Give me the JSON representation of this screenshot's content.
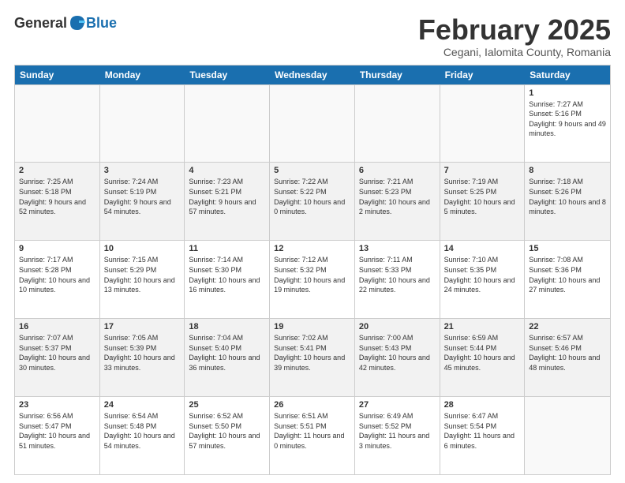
{
  "header": {
    "logo": {
      "general": "General",
      "blue": "Blue"
    },
    "title": "February 2025",
    "location": "Cegani, Ialomita County, Romania"
  },
  "weekdays": [
    "Sunday",
    "Monday",
    "Tuesday",
    "Wednesday",
    "Thursday",
    "Friday",
    "Saturday"
  ],
  "weeks": [
    [
      {
        "day": "",
        "info": ""
      },
      {
        "day": "",
        "info": ""
      },
      {
        "day": "",
        "info": ""
      },
      {
        "day": "",
        "info": ""
      },
      {
        "day": "",
        "info": ""
      },
      {
        "day": "",
        "info": ""
      },
      {
        "day": "1",
        "info": "Sunrise: 7:27 AM\nSunset: 5:16 PM\nDaylight: 9 hours and 49 minutes."
      }
    ],
    [
      {
        "day": "2",
        "info": "Sunrise: 7:25 AM\nSunset: 5:18 PM\nDaylight: 9 hours and 52 minutes."
      },
      {
        "day": "3",
        "info": "Sunrise: 7:24 AM\nSunset: 5:19 PM\nDaylight: 9 hours and 54 minutes."
      },
      {
        "day": "4",
        "info": "Sunrise: 7:23 AM\nSunset: 5:21 PM\nDaylight: 9 hours and 57 minutes."
      },
      {
        "day": "5",
        "info": "Sunrise: 7:22 AM\nSunset: 5:22 PM\nDaylight: 10 hours and 0 minutes."
      },
      {
        "day": "6",
        "info": "Sunrise: 7:21 AM\nSunset: 5:23 PM\nDaylight: 10 hours and 2 minutes."
      },
      {
        "day": "7",
        "info": "Sunrise: 7:19 AM\nSunset: 5:25 PM\nDaylight: 10 hours and 5 minutes."
      },
      {
        "day": "8",
        "info": "Sunrise: 7:18 AM\nSunset: 5:26 PM\nDaylight: 10 hours and 8 minutes."
      }
    ],
    [
      {
        "day": "9",
        "info": "Sunrise: 7:17 AM\nSunset: 5:28 PM\nDaylight: 10 hours and 10 minutes."
      },
      {
        "day": "10",
        "info": "Sunrise: 7:15 AM\nSunset: 5:29 PM\nDaylight: 10 hours and 13 minutes."
      },
      {
        "day": "11",
        "info": "Sunrise: 7:14 AM\nSunset: 5:30 PM\nDaylight: 10 hours and 16 minutes."
      },
      {
        "day": "12",
        "info": "Sunrise: 7:12 AM\nSunset: 5:32 PM\nDaylight: 10 hours and 19 minutes."
      },
      {
        "day": "13",
        "info": "Sunrise: 7:11 AM\nSunset: 5:33 PM\nDaylight: 10 hours and 22 minutes."
      },
      {
        "day": "14",
        "info": "Sunrise: 7:10 AM\nSunset: 5:35 PM\nDaylight: 10 hours and 24 minutes."
      },
      {
        "day": "15",
        "info": "Sunrise: 7:08 AM\nSunset: 5:36 PM\nDaylight: 10 hours and 27 minutes."
      }
    ],
    [
      {
        "day": "16",
        "info": "Sunrise: 7:07 AM\nSunset: 5:37 PM\nDaylight: 10 hours and 30 minutes."
      },
      {
        "day": "17",
        "info": "Sunrise: 7:05 AM\nSunset: 5:39 PM\nDaylight: 10 hours and 33 minutes."
      },
      {
        "day": "18",
        "info": "Sunrise: 7:04 AM\nSunset: 5:40 PM\nDaylight: 10 hours and 36 minutes."
      },
      {
        "day": "19",
        "info": "Sunrise: 7:02 AM\nSunset: 5:41 PM\nDaylight: 10 hours and 39 minutes."
      },
      {
        "day": "20",
        "info": "Sunrise: 7:00 AM\nSunset: 5:43 PM\nDaylight: 10 hours and 42 minutes."
      },
      {
        "day": "21",
        "info": "Sunrise: 6:59 AM\nSunset: 5:44 PM\nDaylight: 10 hours and 45 minutes."
      },
      {
        "day": "22",
        "info": "Sunrise: 6:57 AM\nSunset: 5:46 PM\nDaylight: 10 hours and 48 minutes."
      }
    ],
    [
      {
        "day": "23",
        "info": "Sunrise: 6:56 AM\nSunset: 5:47 PM\nDaylight: 10 hours and 51 minutes."
      },
      {
        "day": "24",
        "info": "Sunrise: 6:54 AM\nSunset: 5:48 PM\nDaylight: 10 hours and 54 minutes."
      },
      {
        "day": "25",
        "info": "Sunrise: 6:52 AM\nSunset: 5:50 PM\nDaylight: 10 hours and 57 minutes."
      },
      {
        "day": "26",
        "info": "Sunrise: 6:51 AM\nSunset: 5:51 PM\nDaylight: 11 hours and 0 minutes."
      },
      {
        "day": "27",
        "info": "Sunrise: 6:49 AM\nSunset: 5:52 PM\nDaylight: 11 hours and 3 minutes."
      },
      {
        "day": "28",
        "info": "Sunrise: 6:47 AM\nSunset: 5:54 PM\nDaylight: 11 hours and 6 minutes."
      },
      {
        "day": "",
        "info": ""
      }
    ]
  ]
}
